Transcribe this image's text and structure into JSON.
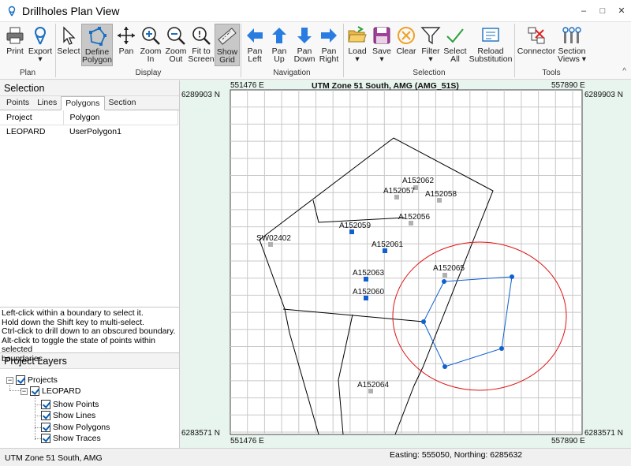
{
  "window": {
    "title": "Drillholes Plan View",
    "icon": "location-pin-icon",
    "controls": [
      "minimize",
      "maximize",
      "close"
    ]
  },
  "ribbon": {
    "groups": [
      {
        "label": "Plan",
        "buttons": [
          {
            "id": "print",
            "label": "Print",
            "icon": "printer-icon"
          },
          {
            "id": "export",
            "label": "Export\n▾",
            "icon": "export-pin-icon"
          }
        ]
      },
      {
        "label": "Display",
        "buttons": [
          {
            "id": "select",
            "label": "Select",
            "icon": "cursor-arrow-icon"
          },
          {
            "id": "define_polygon",
            "label": "Define\nPolygon",
            "icon": "polygon-icon",
            "active": true
          },
          {
            "id": "pan",
            "label": "Pan",
            "icon": "move-arrows-icon"
          },
          {
            "id": "zoom_in",
            "label": "Zoom\nIn",
            "icon": "zoom-in-icon"
          },
          {
            "id": "zoom_out",
            "label": "Zoom\nOut",
            "icon": "zoom-out-icon"
          },
          {
            "id": "fit_to_screen",
            "label": "Fit to\nScreen",
            "icon": "fit-screen-icon"
          },
          {
            "id": "show_grid",
            "label": "Show\nGrid",
            "icon": "ruler-icon",
            "active": true
          }
        ]
      },
      {
        "label": "Navigation",
        "buttons": [
          {
            "id": "pan_left",
            "label": "Pan\nLeft",
            "icon": "arrow-left-icon"
          },
          {
            "id": "pan_up",
            "label": "Pan\nUp",
            "icon": "arrow-up-icon"
          },
          {
            "id": "pan_down",
            "label": "Pan\nDown",
            "icon": "arrow-down-icon"
          },
          {
            "id": "pan_right",
            "label": "Pan\nRight",
            "icon": "arrow-right-icon"
          }
        ]
      },
      {
        "label": "Selection",
        "buttons": [
          {
            "id": "load",
            "label": "Load\n▾",
            "icon": "folder-open-icon"
          },
          {
            "id": "save",
            "label": "Save\n▾",
            "icon": "save-disk-icon"
          },
          {
            "id": "clear",
            "label": "Clear",
            "icon": "clear-circle-icon"
          },
          {
            "id": "filter",
            "label": "Filter\n▾",
            "icon": "funnel-icon"
          },
          {
            "id": "select_all",
            "label": "Select\nAll",
            "icon": "checkmark-icon"
          },
          {
            "id": "reload_substitution",
            "label": "Reload\nSubstitution",
            "icon": "reload-document-icon"
          }
        ]
      },
      {
        "label": "Tools",
        "buttons": [
          {
            "id": "connector",
            "label": "Connector",
            "icon": "connector-icon"
          },
          {
            "id": "section_views",
            "label": "Section\nViews ▾",
            "icon": "section-views-icon"
          }
        ]
      }
    ],
    "collapse_glyph": "^"
  },
  "selection": {
    "header": "Selection",
    "tabs": [
      "Points",
      "Lines",
      "Polygons",
      "Section"
    ],
    "active_tab": "Polygons",
    "table": {
      "columns": [
        "Project",
        "Polygon"
      ],
      "rows": [
        [
          "LEOPARD",
          "UserPolygon1"
        ]
      ]
    },
    "help_lines": [
      "Left-click within a boundary to select it.",
      "Hold down the Shift key to multi-select.",
      "Ctrl-click to drill down to an obscured boundary.",
      "Alt-click to toggle the state of points within selected",
      "boundaries."
    ]
  },
  "layers": {
    "header": "Project Layers",
    "tree": {
      "root": "Projects",
      "project": "LEOPARD",
      "items": [
        "Show Points",
        "Show Lines",
        "Show Polygons",
        "Show Traces"
      ]
    }
  },
  "map": {
    "title": "UTM Zone 51 South, AMG (AMG_51S)",
    "easting_labels": {
      "left": "551476 E",
      "right": "557890 E"
    },
    "northing_labels": {
      "top": "6289903 N",
      "bottom": "6283571 N"
    },
    "colors": {
      "boundary": "#000000",
      "selected_polygon": "#1060d0",
      "ellipse": "#e01010",
      "drillhole_selected": "#1060d0",
      "drillhole_unselected": "#b0b0b0",
      "grid": "#c8c8c8"
    },
    "drillholes": [
      {
        "id": "A152062",
        "selected": false
      },
      {
        "id": "A152057",
        "selected": false
      },
      {
        "id": "A152058",
        "selected": false
      },
      {
        "id": "A152056",
        "selected": false
      },
      {
        "id": "A152059",
        "selected": true
      },
      {
        "id": "A152061",
        "selected": true
      },
      {
        "id": "SW02402",
        "selected": false
      },
      {
        "id": "A152065",
        "selected": true
      },
      {
        "id": "A152063",
        "selected": true
      },
      {
        "id": "A152060",
        "selected": true
      },
      {
        "id": "A152064",
        "selected": false
      }
    ]
  },
  "status": {
    "projection": "UTM Zone 51 South, AMG",
    "coordinates": "Easting: 555050, Northing: 6285632"
  }
}
